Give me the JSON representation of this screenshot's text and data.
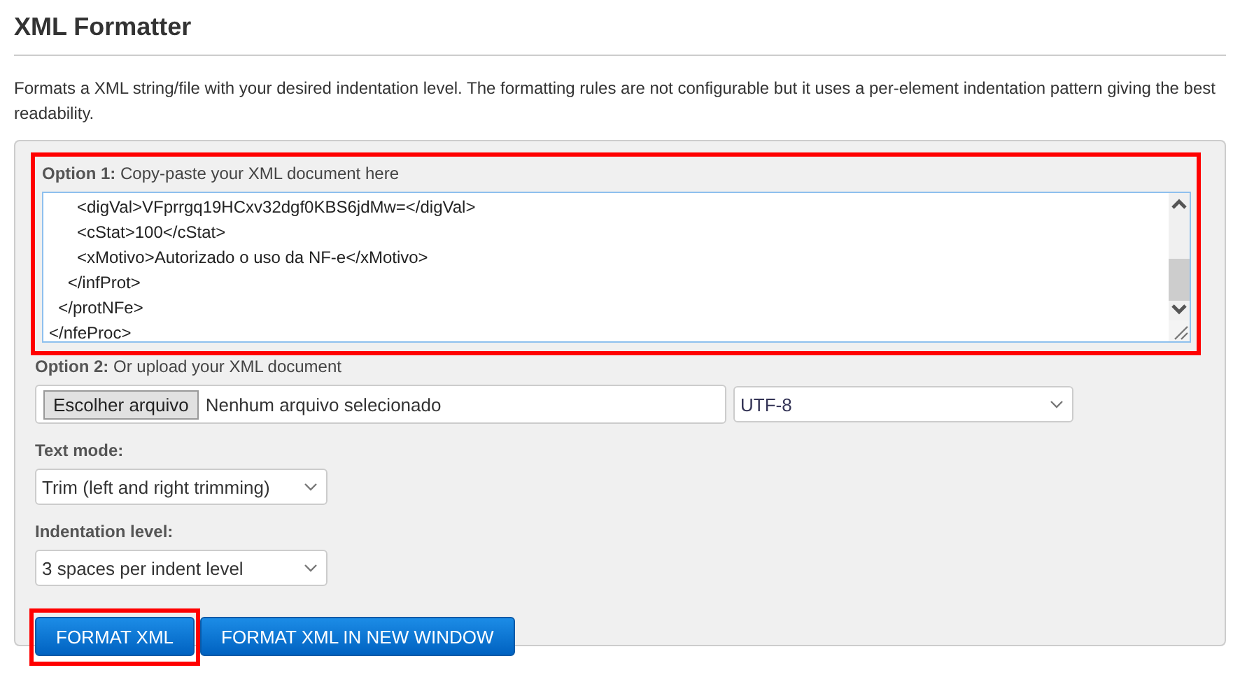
{
  "page": {
    "title": "XML Formatter",
    "description": "Formats a XML string/file with your desired indentation level. The formatting rules are not configurable but it uses a per-element indentation pattern giving the best readability."
  },
  "option1": {
    "label": "**Option 1:** Copy-paste your XML document here",
    "highlighted": true,
    "lines": [
      "      <digVal>VFprrgq19HCxv32dgf0KBS6jdMw=</digVal>",
      "      <cStat>100</cStat>",
      "      <xMotivo>Autorizado o uso da NF-e</xMotivo>",
      "    </infProt>",
      "  </protNFe>",
      "</nfeProc>"
    ]
  },
  "option2": {
    "label": "**Option 2:** Or upload your XML document",
    "file_button": "Escolher arquivo",
    "file_status": "Nenhum arquivo selecionado",
    "encoding": "UTF-8"
  },
  "text_mode": {
    "label": "Text mode:",
    "value": "Trim (left and right trimming)"
  },
  "indentation": {
    "label": "Indentation level:",
    "value": "3 spaces per indent level"
  },
  "buttons": [
    {
      "label": "FORMAT XML",
      "highlighted": true
    },
    {
      "label": "FORMAT XML IN NEW WINDOW",
      "highlighted": false
    }
  ]
}
